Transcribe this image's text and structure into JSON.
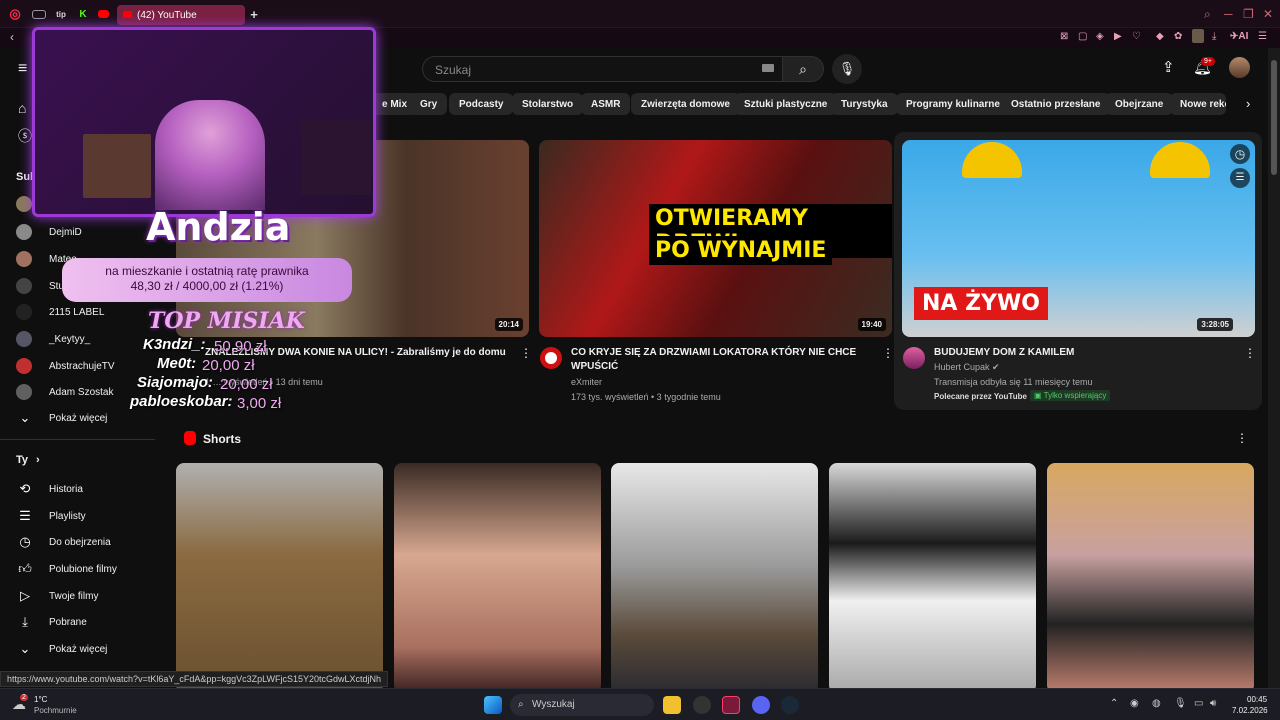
{
  "browser": {
    "tab_title": "(42) YouTube",
    "new_tab": "+",
    "ai_label": "AI",
    "status_url": "https://www.youtube.com/watch?v=tKl6aY_cFdA&pp=kggVc3ZpLWFjcS15Y20tcGdwLXctdjNh"
  },
  "header": {
    "search_placeholder": "Szukaj",
    "notifications_badge": "9+"
  },
  "chips": [
    "e Mix",
    "Gry",
    "Podcasty",
    "Stolarstwo",
    "ASMR",
    "Zwierzęta domowe",
    "Sztuki plastyczne",
    "Turystyka",
    "Programy kulinarne",
    "Ostatnio przesłane",
    "Obejrzane",
    "Nowe reko"
  ],
  "sidebar": {
    "subs_title": "Sub",
    "subscriptions": [
      {
        "name": "DejmiD",
        "color": "#8a8a8a"
      },
      {
        "name": "Mateo",
        "color": "#a07060"
      },
      {
        "name": "Stuu",
        "color": "#444444"
      },
      {
        "name": "2115 LABEL",
        "color": "#222222"
      },
      {
        "name": "_Keytyy_",
        "color": "#555566"
      },
      {
        "name": "AbstrachujeTV",
        "color": "#c03030"
      },
      {
        "name": "Adam Szostak",
        "color": "#606060"
      }
    ],
    "show_more": "Pokaż więcej",
    "you_title": "Ty",
    "you_items": [
      "Historia",
      "Playlisty",
      "Do obejrzenia",
      "Polubione filmy",
      "Twoje filmy",
      "Pobrane"
    ],
    "show_more_2": "Pokaż więcej"
  },
  "videos": [
    {
      "title": "ZNALEŹLIŚMY DWA KONIE NA ULICY! - Zabraliśmy je do domu",
      "meta": "1 … wyświetleń • 13 dni temu",
      "duration": "20:14"
    },
    {
      "title": "CO KRYJE SIĘ ZA DRZWIAMI LOKATORA KTÓRY NIE CHCE WPUŚCIĆ",
      "channel": "eXmiter",
      "meta": "173 tys. wyświetleń • 3 tygodnie temu",
      "duration": "19:40",
      "thumb_text_1": "OTWIERAMY DRZWI",
      "thumb_text_2": "PO WYNAJMIE"
    },
    {
      "title": "BUDUJEMY DOM Z KAMILEM",
      "channel": "Hubert Cupak",
      "meta": "Transmisja odbyła się 11 miesięcy temu",
      "promoted": "Polecane przez YouTube",
      "supporting": "Tylko wspierający",
      "duration": "3:28:05",
      "thumb_text": "NA ŻYWO"
    }
  ],
  "shorts": {
    "title": "Shorts"
  },
  "overlay": {
    "streamer_name": "Andzia",
    "goal_line_1": "na mieszkanie i ostatnią ratę prawnika",
    "goal_line_2": "48,30 zł  /  4000,00 zł  (1.21%)",
    "top_title": "TOP MISIAK",
    "donors": [
      {
        "name": "K3ndzi_:",
        "amount": "50,90 zł"
      },
      {
        "name": "Me0t:",
        "amount": "20,00 zł"
      },
      {
        "name": "Siajomajo:",
        "amount": "20,00 zł"
      },
      {
        "name": "pabloeskobar:",
        "amount": "3,00 zł"
      }
    ]
  },
  "taskbar": {
    "weather_temp": "1°C",
    "weather_desc": "Pochmurnie",
    "search": "Wyszukaj",
    "time": "00:45",
    "date": "7.02.2026",
    "weather_badge": "2"
  }
}
